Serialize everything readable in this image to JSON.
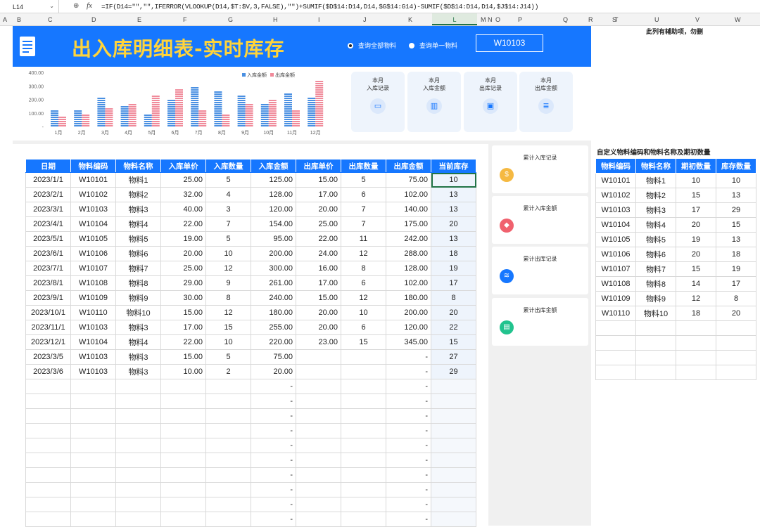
{
  "formula_bar": {
    "cell_ref": "L14",
    "zoom_icon": "zoom-icon",
    "fx": "fx",
    "formula": "=IF(D14=\"\",\"\",IFERROR(VLOOKUP(D14,$T:$V,3,FALSE),\"\")+SUMIF($D$14:D14,D14,$G$14:G14)-SUMIF($D$14:D14,D14,$J$14:J14))"
  },
  "column_headers": [
    "A",
    "B",
    "C",
    "D",
    "E",
    "F",
    "G",
    "H",
    "I",
    "J",
    "K",
    "L",
    "M",
    "N",
    "O",
    "P",
    "Q",
    "R",
    "S",
    "T",
    "U",
    "V",
    "W"
  ],
  "header": {
    "title": "出入库明细表-实时库存",
    "radio_all": "查询全部物料",
    "radio_single": "查询单一物料",
    "code": "W10103",
    "help_note": "此列有辅助项，勿删"
  },
  "kpi_cards": [
    {
      "line1": "本月",
      "line2": "入库记录",
      "icon": "monitor-icon"
    },
    {
      "line1": "本月",
      "line2": "入库金额",
      "icon": "chart-icon"
    },
    {
      "line1": "本月",
      "line2": "出库记录",
      "icon": "screen-icon"
    },
    {
      "line1": "本月",
      "line2": "出库金额",
      "icon": "document-icon"
    }
  ],
  "side_cards": [
    {
      "label": "累计入库记录",
      "icon": "money-bag-icon",
      "color": "#f5b942"
    },
    {
      "label": "累计入库金额",
      "icon": "box-icon",
      "color": "#f0616e"
    },
    {
      "label": "累计出库记录",
      "icon": "layers-icon",
      "color": "#1677ff"
    },
    {
      "label": "累计出库金额",
      "icon": "file-icon",
      "color": "#22c38e"
    }
  ],
  "chart_data": {
    "type": "bar",
    "categories": [
      "1月",
      "2月",
      "3月",
      "4月",
      "5月",
      "6月",
      "7月",
      "8月",
      "9月",
      "10月",
      "11月",
      "12月"
    ],
    "series": [
      {
        "name": "入库金额",
        "color": "#4a90e2",
        "values": [
          125,
          128,
          220,
          154,
          95,
          200,
          300,
          261,
          240,
          180,
          255,
          220
        ]
      },
      {
        "name": "出库金额",
        "color": "#f08a9a",
        "values": [
          75,
          102,
          140,
          175,
          242,
          288,
          128,
          102,
          180,
          200,
          120,
          345
        ]
      }
    ],
    "y_ticks": [
      "400.00",
      "300.00",
      "200.00",
      "100.00",
      "-"
    ],
    "ylim": [
      0,
      400
    ],
    "legend_position": "top-right"
  },
  "main_table": {
    "headers": [
      "日期",
      "物料编码",
      "物料名称",
      "入库单价",
      "入库数量",
      "入库金额",
      "出库单价",
      "出库数量",
      "出库金额",
      "当前库存"
    ],
    "rows": [
      [
        "2023/1/1",
        "W10101",
        "物料1",
        "25.00",
        "5",
        "125.00",
        "15.00",
        "5",
        "75.00",
        "10"
      ],
      [
        "2023/2/1",
        "W10102",
        "物料2",
        "32.00",
        "4",
        "128.00",
        "17.00",
        "6",
        "102.00",
        "13"
      ],
      [
        "2023/3/1",
        "W10103",
        "物料3",
        "40.00",
        "3",
        "120.00",
        "20.00",
        "7",
        "140.00",
        "13"
      ],
      [
        "2023/4/1",
        "W10104",
        "物料4",
        "22.00",
        "7",
        "154.00",
        "25.00",
        "7",
        "175.00",
        "20"
      ],
      [
        "2023/5/1",
        "W10105",
        "物料5",
        "19.00",
        "5",
        "95.00",
        "22.00",
        "11",
        "242.00",
        "13"
      ],
      [
        "2023/6/1",
        "W10106",
        "物料6",
        "20.00",
        "10",
        "200.00",
        "24.00",
        "12",
        "288.00",
        "18"
      ],
      [
        "2023/7/1",
        "W10107",
        "物料7",
        "25.00",
        "12",
        "300.00",
        "16.00",
        "8",
        "128.00",
        "19"
      ],
      [
        "2023/8/1",
        "W10108",
        "物料8",
        "29.00",
        "9",
        "261.00",
        "17.00",
        "6",
        "102.00",
        "17"
      ],
      [
        "2023/9/1",
        "W10109",
        "物料9",
        "30.00",
        "8",
        "240.00",
        "15.00",
        "12",
        "180.00",
        "8"
      ],
      [
        "2023/10/1",
        "W10110",
        "物料10",
        "15.00",
        "12",
        "180.00",
        "20.00",
        "10",
        "200.00",
        "20"
      ],
      [
        "2023/11/1",
        "W10103",
        "物料3",
        "17.00",
        "15",
        "255.00",
        "20.00",
        "6",
        "120.00",
        "22"
      ],
      [
        "2023/12/1",
        "W10104",
        "物料4",
        "22.00",
        "10",
        "220.00",
        "23.00",
        "15",
        "345.00",
        "15"
      ],
      [
        "2023/3/5",
        "W10103",
        "物料3",
        "15.00",
        "5",
        "75.00",
        "",
        "",
        "-",
        "27"
      ],
      [
        "2023/3/6",
        "W10103",
        "物料3",
        "10.00",
        "2",
        "20.00",
        "",
        "",
        "-",
        "29"
      ]
    ],
    "empty_dash": "-"
  },
  "right_table": {
    "title": "自定义物料编码和物料名称及期初数量",
    "headers": [
      "物料编码",
      "物料名称",
      "期初数量",
      "库存数量"
    ],
    "rows": [
      [
        "W10101",
        "物料1",
        "10",
        "10"
      ],
      [
        "W10102",
        "物料2",
        "15",
        "13"
      ],
      [
        "W10103",
        "物料3",
        "17",
        "29"
      ],
      [
        "W10104",
        "物料4",
        "20",
        "15"
      ],
      [
        "W10105",
        "物料5",
        "19",
        "13"
      ],
      [
        "W10106",
        "物料6",
        "20",
        "18"
      ],
      [
        "W10107",
        "物料7",
        "15",
        "19"
      ],
      [
        "W10108",
        "物料8",
        "14",
        "17"
      ],
      [
        "W10109",
        "物料9",
        "12",
        "8"
      ],
      [
        "W10110",
        "物料10",
        "18",
        "20"
      ]
    ]
  }
}
